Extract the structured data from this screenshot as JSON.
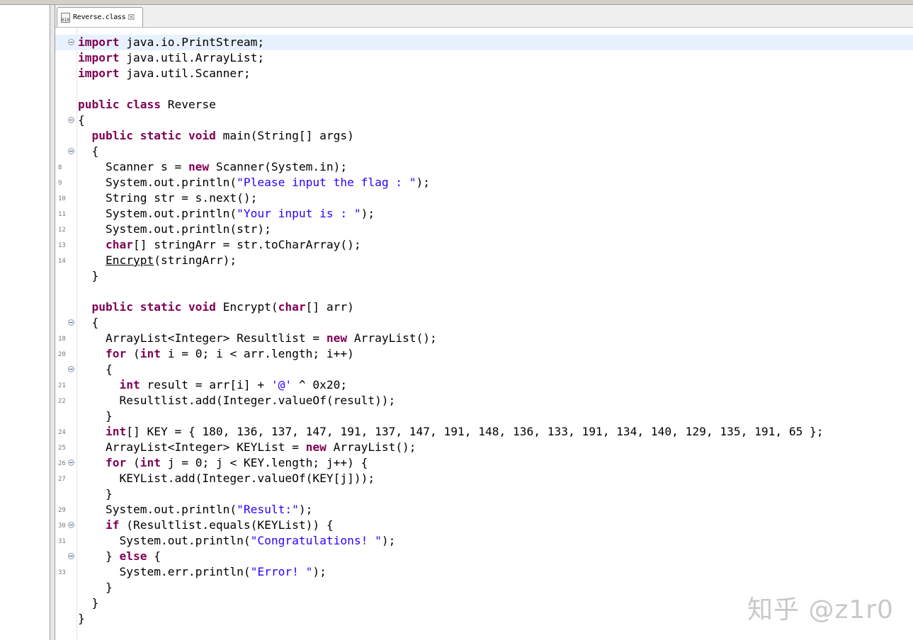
{
  "tab": {
    "label": "Reverse.class",
    "icon": "class-file-icon",
    "close_icon": "close-icon"
  },
  "watermark": "知乎 @z1r0",
  "lines": [
    {
      "ln": "",
      "fold": true,
      "current": true,
      "parts": [
        [
          "kw",
          "import"
        ],
        [
          "t",
          " java.io.PrintStream;"
        ]
      ]
    },
    {
      "ln": "",
      "fold": false,
      "parts": [
        [
          "kw",
          "import"
        ],
        [
          "t",
          " java.util.ArrayList;"
        ]
      ]
    },
    {
      "ln": "",
      "fold": false,
      "parts": [
        [
          "kw",
          "import"
        ],
        [
          "t",
          " java.util.Scanner;"
        ]
      ]
    },
    {
      "ln": "",
      "fold": false,
      "parts": []
    },
    {
      "ln": "",
      "fold": false,
      "parts": [
        [
          "kw",
          "public class"
        ],
        [
          "t",
          " Reverse"
        ]
      ]
    },
    {
      "ln": "",
      "fold": true,
      "parts": [
        [
          "t",
          "{"
        ]
      ]
    },
    {
      "ln": "",
      "fold": false,
      "parts": [
        [
          "t",
          "  "
        ],
        [
          "kw",
          "public static void"
        ],
        [
          "t",
          " main(String[] args)"
        ]
      ]
    },
    {
      "ln": "",
      "fold": true,
      "parts": [
        [
          "t",
          "  {"
        ]
      ]
    },
    {
      "ln": "8",
      "fold": false,
      "parts": [
        [
          "t",
          "    Scanner s = "
        ],
        [
          "kw",
          "new"
        ],
        [
          "t",
          " Scanner(System.in);"
        ]
      ]
    },
    {
      "ln": "9",
      "fold": false,
      "parts": [
        [
          "t",
          "    System.out.println("
        ],
        [
          "str",
          "\"Please input the flag : \""
        ],
        [
          "t",
          ");"
        ]
      ]
    },
    {
      "ln": "10",
      "fold": false,
      "parts": [
        [
          "t",
          "    String str = s.next();"
        ]
      ]
    },
    {
      "ln": "11",
      "fold": false,
      "parts": [
        [
          "t",
          "    System.out.println("
        ],
        [
          "str",
          "\"Your input is : \""
        ],
        [
          "t",
          ");"
        ]
      ]
    },
    {
      "ln": "12",
      "fold": false,
      "parts": [
        [
          "t",
          "    System.out.println(str);"
        ]
      ]
    },
    {
      "ln": "13",
      "fold": false,
      "parts": [
        [
          "t",
          "    "
        ],
        [
          "kw",
          "char"
        ],
        [
          "t",
          "[] stringArr = str.toCharArray();"
        ]
      ]
    },
    {
      "ln": "14",
      "fold": false,
      "parts": [
        [
          "t",
          "    "
        ],
        [
          "und",
          "Encrypt"
        ],
        [
          "t",
          "(stringArr);"
        ]
      ]
    },
    {
      "ln": "",
      "fold": false,
      "parts": [
        [
          "t",
          "  }"
        ]
      ]
    },
    {
      "ln": "",
      "fold": false,
      "parts": []
    },
    {
      "ln": "",
      "fold": false,
      "parts": [
        [
          "t",
          "  "
        ],
        [
          "kw",
          "public static void"
        ],
        [
          "t",
          " Encrypt("
        ],
        [
          "kw",
          "char"
        ],
        [
          "t",
          "[] arr)"
        ]
      ]
    },
    {
      "ln": "",
      "fold": true,
      "parts": [
        [
          "t",
          "  {"
        ]
      ]
    },
    {
      "ln": "18",
      "fold": false,
      "parts": [
        [
          "t",
          "    ArrayList<Integer> Resultlist = "
        ],
        [
          "kw",
          "new"
        ],
        [
          "t",
          " ArrayList();"
        ]
      ]
    },
    {
      "ln": "20",
      "fold": false,
      "parts": [
        [
          "t",
          "    "
        ],
        [
          "kw",
          "for"
        ],
        [
          "t",
          " ("
        ],
        [
          "kw",
          "int"
        ],
        [
          "t",
          " i = 0; i < arr.length; i++)"
        ]
      ]
    },
    {
      "ln": "",
      "fold": true,
      "parts": [
        [
          "t",
          "    {"
        ]
      ]
    },
    {
      "ln": "21",
      "fold": false,
      "parts": [
        [
          "t",
          "      "
        ],
        [
          "kw",
          "int"
        ],
        [
          "t",
          " result = arr[i] + "
        ],
        [
          "str",
          "'@'"
        ],
        [
          "t",
          " ^ 0x20;"
        ]
      ]
    },
    {
      "ln": "22",
      "fold": false,
      "parts": [
        [
          "t",
          "      Resultlist.add(Integer.valueOf(result));"
        ]
      ]
    },
    {
      "ln": "",
      "fold": false,
      "parts": [
        [
          "t",
          "    }"
        ]
      ]
    },
    {
      "ln": "24",
      "fold": false,
      "parts": [
        [
          "t",
          "    "
        ],
        [
          "kw",
          "int"
        ],
        [
          "t",
          "[] KEY = { 180, 136, 137, 147, 191, 137, 147, 191, 148, 136, 133, 191, 134, 140, 129, 135, 191, 65 };"
        ]
      ]
    },
    {
      "ln": "25",
      "fold": false,
      "parts": [
        [
          "t",
          "    ArrayList<Integer> KEYList = "
        ],
        [
          "kw",
          "new"
        ],
        [
          "t",
          " ArrayList();"
        ]
      ]
    },
    {
      "ln": "26",
      "fold": true,
      "parts": [
        [
          "t",
          "    "
        ],
        [
          "kw",
          "for"
        ],
        [
          "t",
          " ("
        ],
        [
          "kw",
          "int"
        ],
        [
          "t",
          " j = 0; j < KEY.length; j++) {"
        ]
      ]
    },
    {
      "ln": "27",
      "fold": false,
      "parts": [
        [
          "t",
          "      KEYList.add(Integer.valueOf(KEY[j]));"
        ]
      ]
    },
    {
      "ln": "",
      "fold": false,
      "parts": [
        [
          "t",
          "    }"
        ]
      ]
    },
    {
      "ln": "29",
      "fold": false,
      "parts": [
        [
          "t",
          "    System.out.println("
        ],
        [
          "str",
          "\"Result:\""
        ],
        [
          "t",
          ");"
        ]
      ]
    },
    {
      "ln": "30",
      "fold": true,
      "parts": [
        [
          "t",
          "    "
        ],
        [
          "kw",
          "if"
        ],
        [
          "t",
          " (Resultlist.equals(KEYList)) {"
        ]
      ]
    },
    {
      "ln": "31",
      "fold": false,
      "parts": [
        [
          "t",
          "      System.out.println("
        ],
        [
          "str",
          "\"Congratulations! \""
        ],
        [
          "t",
          ");"
        ]
      ]
    },
    {
      "ln": "",
      "fold": true,
      "parts": [
        [
          "t",
          "    } "
        ],
        [
          "kw",
          "else"
        ],
        [
          "t",
          " {"
        ]
      ]
    },
    {
      "ln": "33",
      "fold": false,
      "parts": [
        [
          "t",
          "      System.err.println("
        ],
        [
          "str",
          "\"Error! \""
        ],
        [
          "t",
          ");"
        ]
      ]
    },
    {
      "ln": "",
      "fold": false,
      "parts": [
        [
          "t",
          "    }"
        ]
      ]
    },
    {
      "ln": "",
      "fold": false,
      "parts": [
        [
          "t",
          "  }"
        ]
      ]
    },
    {
      "ln": "",
      "fold": false,
      "parts": [
        [
          "t",
          "}"
        ]
      ]
    }
  ]
}
